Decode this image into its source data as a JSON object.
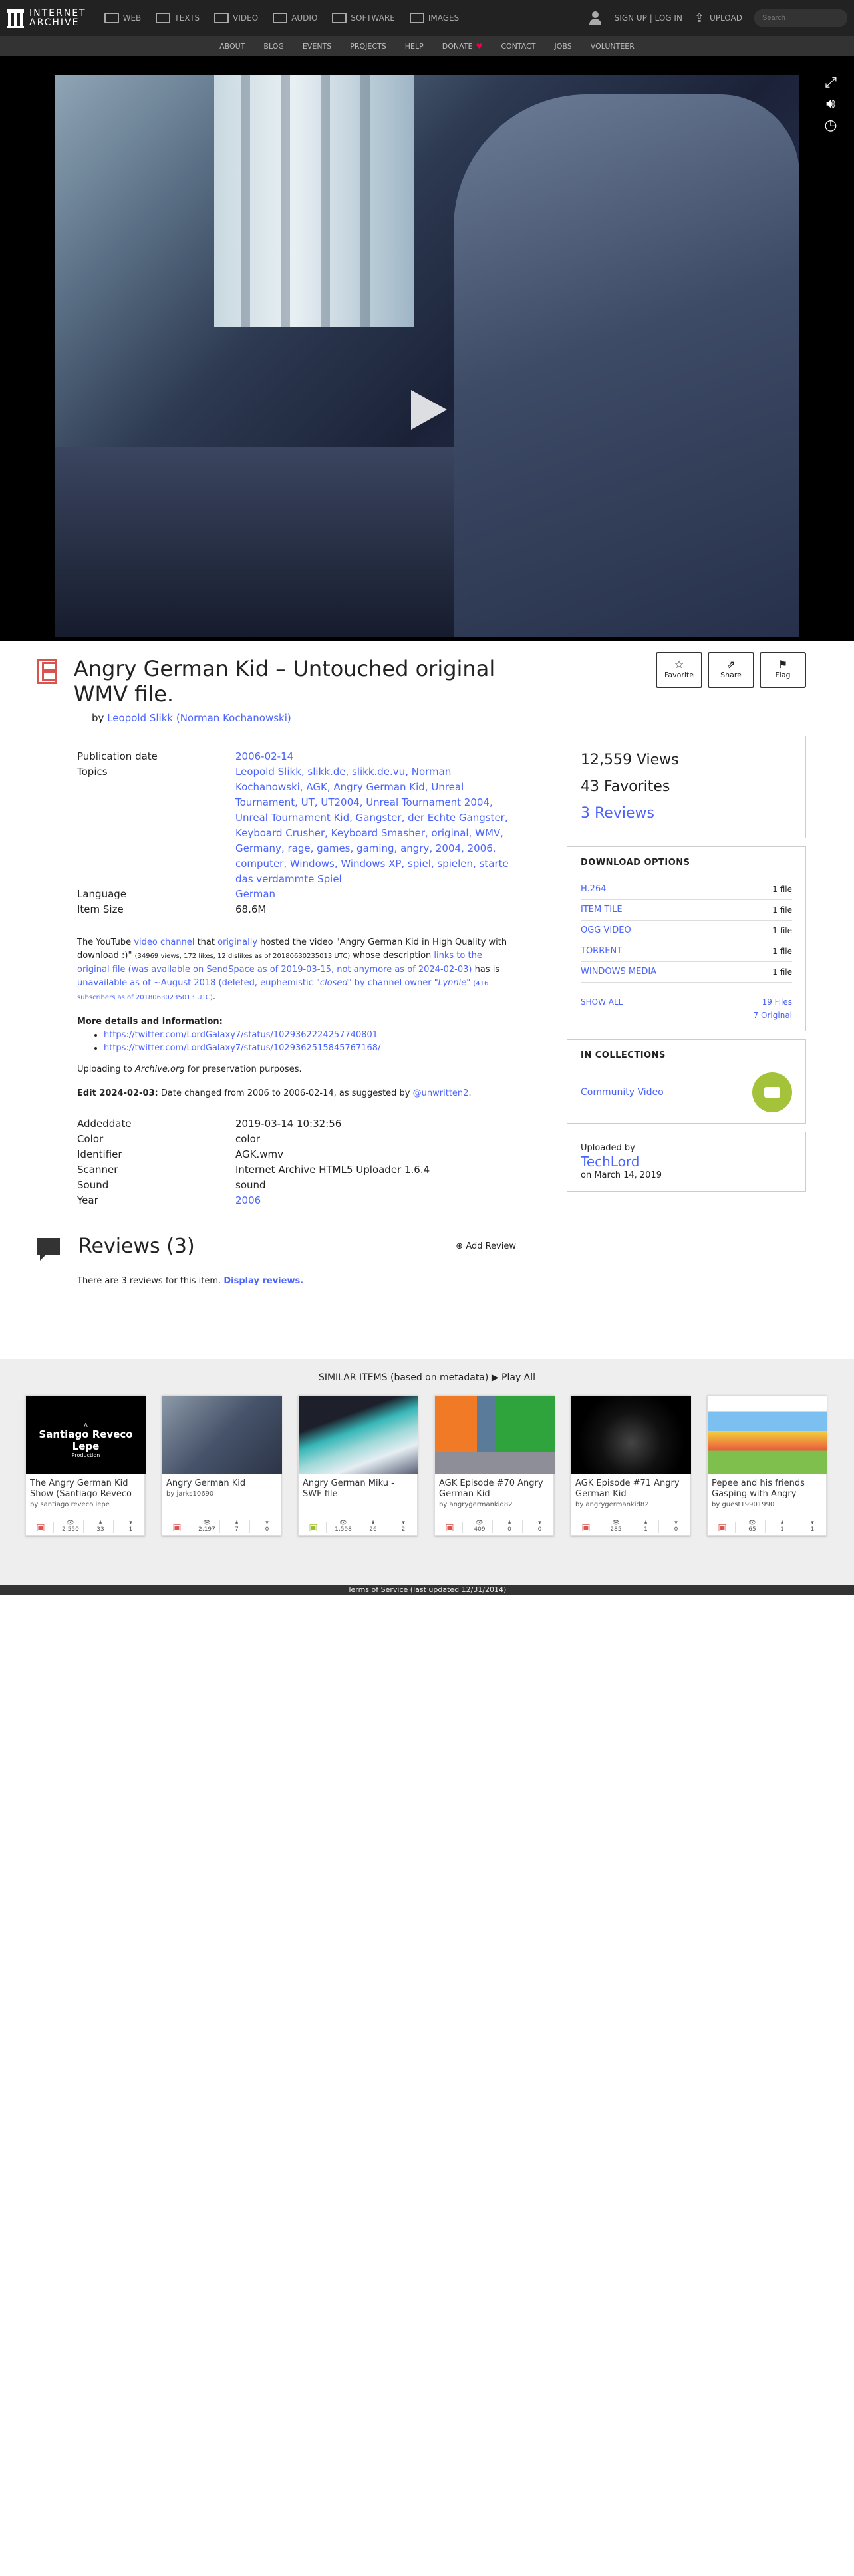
{
  "header": {
    "logo_line1": "INTERNET",
    "logo_line2": "ARCHIVE",
    "media": [
      {
        "label": "WEB",
        "icon": "web-icon"
      },
      {
        "label": "TEXTS",
        "icon": "book-icon"
      },
      {
        "label": "VIDEO",
        "icon": "film-icon"
      },
      {
        "label": "AUDIO",
        "icon": "speaker-icon"
      },
      {
        "label": "SOFTWARE",
        "icon": "floppy-icon"
      },
      {
        "label": "IMAGES",
        "icon": "image-icon"
      }
    ],
    "sign_up": "SIGN UP | LOG IN",
    "upload": "UPLOAD",
    "search_placeholder": "Search"
  },
  "subnav": [
    "ABOUT",
    "BLOG",
    "EVENTS",
    "PROJECTS",
    "HELP",
    "DONATE",
    "CONTACT",
    "JOBS",
    "VOLUNTEER"
  ],
  "item": {
    "title": "Angry German Kid – Untouched original WMV file.",
    "by_prefix": "by",
    "by": "Leopold Slikk (Norman Kochanowski)",
    "actions": {
      "favorite": "Favorite",
      "share": "Share",
      "flag": "Flag"
    },
    "metadata": {
      "publication_date_label": "Publication date",
      "publication_date": "2006-02-14",
      "topics_label": "Topics",
      "topics": "Leopold Slikk, slikk.de, slikk.de.vu, Norman Kochanowski, AGK, Angry German Kid, Unreal Tournament, UT, UT2004, Unreal Tournament 2004, Unreal Tournament Kid, Gangster, der Echte Gangster, Keyboard Crusher, Keyboard Smasher, original, WMV, Germany, rage, games, gaming, angry, 2004, 2006, computer, Windows, Windows XP, spiel, spielen, starte das verdammte Spiel",
      "language_label": "Language",
      "language": "German",
      "item_size_label": "Item Size",
      "item_size": "68.6M"
    },
    "description": {
      "p1_a": "The YouTube",
      "p1_link1": "video channel",
      "p1_b": "that",
      "p1_link2": "originally",
      "p1_c": "hosted the video \"Angry German Kid in High Quality with download :)\"",
      "p1_small": "(34969 views, 172 likes, 12 dislikes as of 20180630235013 UTC)",
      "p1_d": "whose description",
      "p1_link3": "links to the original file (was available on SendSpace as of 2019-03-15, not anymore as of 2024-02-03)",
      "p1_e": "has is",
      "p1_link4": "unavailable as of ~August 2018 (deleted, euphemistic",
      "p1_link4_em": "\"closed\"",
      "p1_link4_b": "by channel owner",
      "p1_link4_em2": "\"Lynnie\"",
      "p1_link4_small": "(416 subscribers as of 20180630235013 UTC)",
      "p1_end": ".",
      "more_heading": "More details and information:",
      "links": [
        "https://twitter.com/LordGalaxy7/status/1029362224257740801",
        "https://twitter.com/LordGalaxy7/status/1029362515845767168/"
      ],
      "upload_note_a": "Uploading to",
      "upload_note_em": "Archive.org",
      "upload_note_b": "for preservation purposes.",
      "edit_bold": "Edit 2024-02-03:",
      "edit_text": "Date changed from 2006 to 2006-02-14, as suggested by",
      "edit_link": "@unwritten2",
      "edit_end": "."
    },
    "meta2": [
      {
        "k": "Addeddate",
        "v": "2019-03-14 10:32:56",
        "link": false
      },
      {
        "k": "Color",
        "v": "color",
        "link": false
      },
      {
        "k": "Identifier",
        "v": "AGK.wmv",
        "link": false
      },
      {
        "k": "Scanner",
        "v": "Internet Archive HTML5 Uploader 1.6.4",
        "link": false
      },
      {
        "k": "Sound",
        "v": "sound",
        "link": false
      },
      {
        "k": "Year",
        "v": "2006",
        "link": true
      }
    ],
    "reviews": {
      "title": "Reviews (3)",
      "add": "Add Review",
      "text": "There are 3 reviews for this item.",
      "display": "Display reviews."
    }
  },
  "sidebar": {
    "views": "12,559 Views",
    "favorites": "43 Favorites",
    "reviews": "3 Reviews",
    "download_heading": "DOWNLOAD OPTIONS",
    "downloads": [
      {
        "label": "H.264",
        "count": "1 file"
      },
      {
        "label": "ITEM TILE",
        "count": "1 file"
      },
      {
        "label": "OGG VIDEO",
        "count": "1 file"
      },
      {
        "label": "TORRENT",
        "count": "1 file"
      },
      {
        "label": "WINDOWS MEDIA",
        "count": "1 file"
      }
    ],
    "show_all": "SHOW ALL",
    "files": "19 Files",
    "original": "7 Original",
    "collections_heading": "IN COLLECTIONS",
    "collection": "Community Video",
    "uploaded_by": "Uploaded by",
    "uploader": "TechLord",
    "uploaded_on": "on March 14, 2019"
  },
  "similar": {
    "title": "SIMILAR ITEMS (based on metadata)",
    "play_all": "Play All",
    "items": [
      {
        "title": "The Angry German Kid Show (Santiago Reveco",
        "by": "by santiago reveco lepe",
        "views": "2,550",
        "favs": "33",
        "reviews": "1",
        "thumb_text": "Santiago Reveco Lepe",
        "thumb_sub": "Production"
      },
      {
        "title": "Angry German Kid",
        "by": "by jarks10690",
        "views": "2,197",
        "favs": "7",
        "reviews": "0",
        "thumb_text": "",
        "thumb_sub": ""
      },
      {
        "title": "Angry German Miku - SWF file",
        "by": "",
        "views": "1,598",
        "favs": "26",
        "reviews": "2",
        "thumb_text": "",
        "thumb_sub": ""
      },
      {
        "title": "AGK Episode #70 Angry German Kid",
        "by": "by angrygermankid82",
        "views": "409",
        "favs": "0",
        "reviews": "0",
        "thumb_text": "",
        "thumb_sub": ""
      },
      {
        "title": "AGK Episode #71 Angry German Kid",
        "by": "by angrygermankid82",
        "views": "285",
        "favs": "1",
        "reviews": "0",
        "thumb_text": "",
        "thumb_sub": ""
      },
      {
        "title": "Pepee and his friends Gasping with Angry",
        "by": "by guest19901990",
        "views": "65",
        "favs": "1",
        "reviews": "1",
        "thumb_text": "",
        "thumb_sub": ""
      }
    ]
  },
  "footer": "Terms of Service (last updated 12/31/2014)"
}
